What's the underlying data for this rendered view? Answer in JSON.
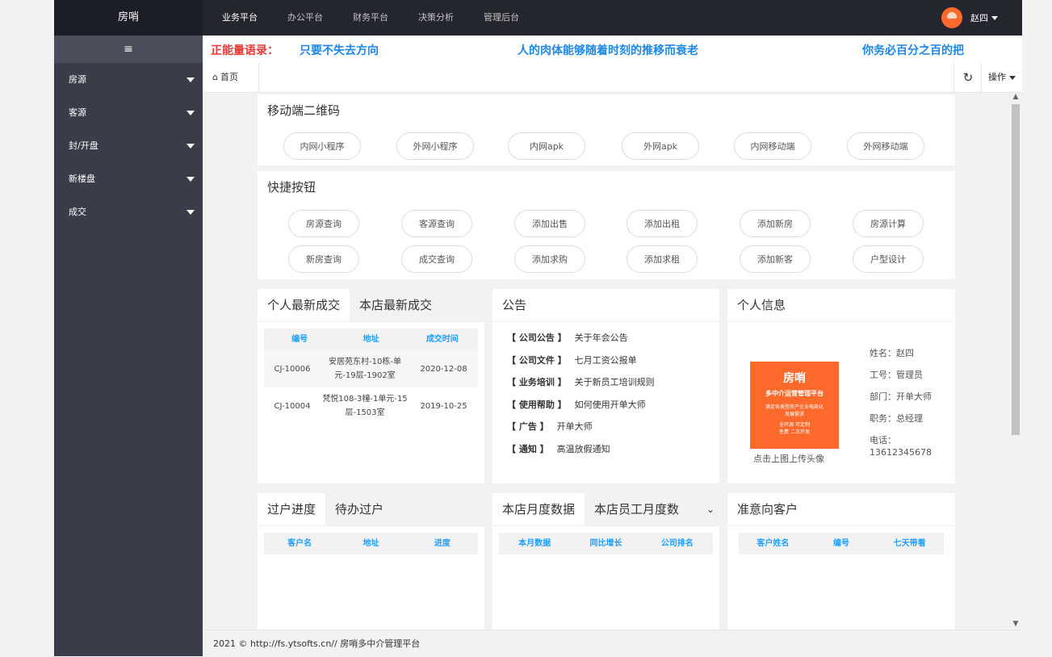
{
  "header": {
    "logo": "房哨",
    "nav": [
      "业务平台",
      "办公平台",
      "财务平台",
      "决策分析",
      "管理后台"
    ],
    "username": "赵四"
  },
  "sidebar": {
    "toggle_icon": "≡",
    "items": [
      {
        "label": "房源"
      },
      {
        "label": "客源"
      },
      {
        "label": "封/开盘"
      },
      {
        "label": "新楼盘"
      },
      {
        "label": "成交"
      }
    ]
  },
  "motto": {
    "label": "正能量语录：",
    "items": [
      "只要不失去方向",
      "人的肉体能够随着时刻的推移而衰老",
      "你务必百分之百的把"
    ]
  },
  "tabbar": {
    "home_icon": "⌂",
    "home_label": "首页",
    "refresh_icon": "↻",
    "ops_label": "操作"
  },
  "qr_section": {
    "title": "移动端二维码",
    "buttons": [
      "内网小程序",
      "外网小程序",
      "内网apk",
      "外网apk",
      "内网移动端",
      "外网移动端"
    ]
  },
  "quick_section": {
    "title": "快捷按钮",
    "row1": [
      "房源查询",
      "客源查询",
      "添加出售",
      "添加出租",
      "添加新房",
      "房源计算"
    ],
    "row2": [
      "新房查询",
      "成交查询",
      "添加求购",
      "添加求租",
      "添加新客",
      "户型设计"
    ]
  },
  "deals": {
    "tabs": [
      "个人最新成交",
      "本店最新成交"
    ],
    "columns": [
      "编号",
      "地址",
      "成交时间"
    ],
    "rows": [
      {
        "id": "CJ-10006",
        "address": "安居苑东村-10栋-单元-19层-1902室",
        "date": "2020-12-08"
      },
      {
        "id": "CJ-10004",
        "address": "梵悦108-3幢-1单元-15层-1503室",
        "date": "2019-10-25"
      }
    ]
  },
  "announcement": {
    "title": "公告",
    "items": [
      {
        "tag": "【 公司公告 】",
        "text": "关于年会公告"
      },
      {
        "tag": "【 公司文件 】",
        "text": "七月工资公报单"
      },
      {
        "tag": "【 业务培训 】",
        "text": "关于新员工培训规则"
      },
      {
        "tag": "【 使用帮助 】",
        "text": "如何使用开单大师"
      },
      {
        "tag": "【 广告 】",
        "text": "开单大师"
      },
      {
        "tag": "【 通知 】",
        "text": "高温放假通知"
      }
    ]
  },
  "profile": {
    "title": "个人信息",
    "avatar_title": "房哨",
    "avatar_sub": "多中介运营管理平台",
    "avatar_line3": "满足各类型房产企业电商化",
    "avatar_line4": "发展需求",
    "avatar_line5": "全开源 可定制",
    "avatar_line6": "免费 二次开发",
    "upload_hint": "点击上图上传头像",
    "name": "姓名：赵四",
    "job_no": "工号：管理员",
    "dept": "部门：开单大师",
    "position": "职务：总经理",
    "phone_label": "电话：",
    "phone": "13612345678"
  },
  "transfer": {
    "tabs": [
      "过户进度",
      "待办过户"
    ],
    "columns": [
      "客户名",
      "地址",
      "进度"
    ]
  },
  "monthly": {
    "tabs": [
      "本店月度数据",
      "本店员工月度数"
    ],
    "columns": [
      "本月数据",
      "同比增长",
      "公司排名"
    ]
  },
  "intent": {
    "title": "准意向客户",
    "columns": [
      "客户姓名",
      "编号",
      "七天带看"
    ]
  },
  "footer": {
    "text": "2021 © http://fs.ytsofts.cn// 房哨多中介管理平台"
  }
}
